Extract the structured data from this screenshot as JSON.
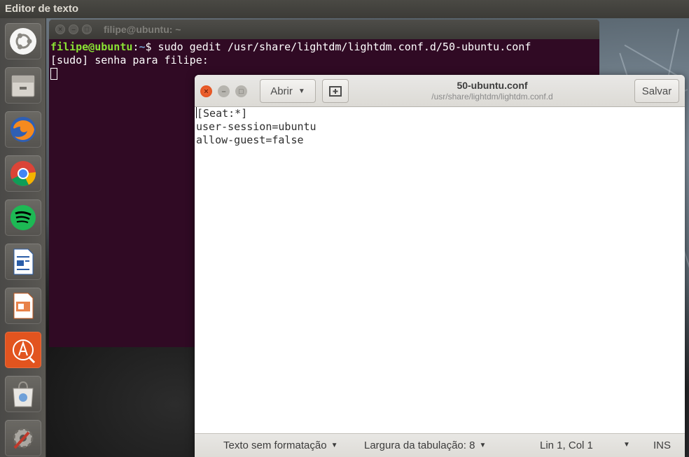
{
  "top_panel": {
    "title": "Editor de texto"
  },
  "launcher": {
    "items": [
      {
        "name": "ubuntu-dash-icon"
      },
      {
        "name": "files-icon"
      },
      {
        "name": "firefox-icon"
      },
      {
        "name": "chrome-icon"
      },
      {
        "name": "spotify-icon"
      },
      {
        "name": "libreoffice-writer-icon"
      },
      {
        "name": "libreoffice-impress-icon"
      },
      {
        "name": "software-updater-icon"
      },
      {
        "name": "ubuntu-software-icon"
      },
      {
        "name": "system-settings-icon"
      }
    ]
  },
  "terminal": {
    "title": "filipe@ubuntu: ~",
    "prompt_user": "filipe@ubuntu",
    "prompt_sep": ":",
    "prompt_path": "~",
    "prompt_symbol": "$ ",
    "command": "sudo gedit /usr/share/lightdm/lightdm.conf.d/50-ubuntu.conf",
    "line2": "[sudo] senha para filipe: "
  },
  "gedit": {
    "open_label": "Abrir",
    "save_label": "Salvar",
    "doc_title": "50-ubuntu.conf",
    "doc_path": "/usr/share/lightdm/lightdm.conf.d",
    "lines": [
      "[Seat:*]",
      "user-session=ubuntu",
      "allow-guest=false"
    ],
    "status": {
      "format": "Texto sem formatação",
      "tab_width": "Largura da tabulação: 8",
      "position": "Lin 1, Col 1",
      "mode": "INS"
    }
  },
  "colors": {
    "terminal_bg": "#300a24",
    "prompt_user": "#8ae234",
    "prompt_path": "#729fcf",
    "close_button": "#e95420"
  }
}
